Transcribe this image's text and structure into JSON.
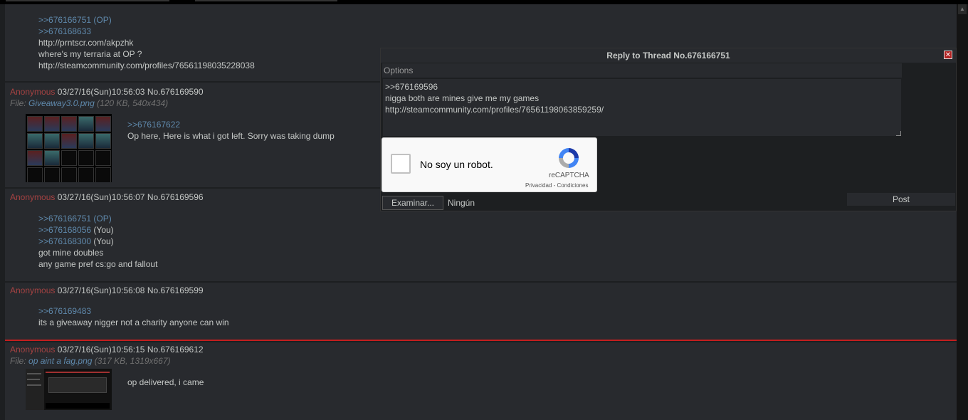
{
  "posts": [
    {
      "lines": [
        {
          "quote": ">>676166751 (OP)"
        },
        {
          "quote": ">>676168633"
        },
        {
          "text": "http://prntscr.com/akpzhk"
        },
        {
          "text": "where's my terraria at OP ?"
        },
        {
          "text": "http://steamcommunity.com/profiles/76561198035228038"
        }
      ]
    },
    {
      "name": "Anonymous",
      "date": "03/27/16(Sun)10:56:03",
      "no": "No.676169590",
      "file_prefix": "File: ",
      "file_name": "Giveaway3.0.png",
      "file_info": " (120 KB, 540x434)",
      "lines": [
        {
          "quote": ">>676167622"
        },
        {
          "text": "Op here, Here is what i got left. Sorry was taking dump"
        }
      ]
    },
    {
      "name": "Anonymous",
      "date": "03/27/16(Sun)10:56:07",
      "no": "No.676169596",
      "lines": [
        {
          "quote": ">>676166751 (OP)"
        },
        {
          "quote": ">>676168056",
          "suffix": " (You)"
        },
        {
          "quote": ">>676168300",
          "suffix": " (You)"
        },
        {
          "text": "got mine doubles"
        },
        {
          "text": "any game pref cs:go and fallout"
        }
      ]
    },
    {
      "name": "Anonymous",
      "date": "03/27/16(Sun)10:56:08",
      "no": "No.676169599",
      "lines": [
        {
          "quote": ">>676169483"
        },
        {
          "text": "its a giveaway nigger not a charity anyone can win"
        }
      ]
    },
    {
      "name": "Anonymous",
      "date": "03/27/16(Sun)10:56:15",
      "no": "No.676169612",
      "file_prefix": "File: ",
      "file_name": "op aint a fag.png",
      "file_info": " (317 KB, 1319x667)",
      "lines": [
        {
          "text": "op delivered, i came"
        }
      ]
    }
  ],
  "quick_reply": {
    "title": "Reply to Thread No.676166751",
    "close_glyph": "✕",
    "options_placeholder": "Options",
    "comment": ">>676169596\nnigga both are mines give me my games\nhttp://steamcommunity.com/profiles/76561198063859259/",
    "captcha_label": "No soy un robot.",
    "captcha_brand": "reCAPTCHA",
    "captcha_links": "Privacidad - Condiciones",
    "file_button": "Examinar...",
    "file_status": "Ningún archivo seleccionado.",
    "post_button": "Post"
  },
  "colors": {
    "background": "#1d1f21",
    "post_bg": "#282a2e",
    "name": "#a54242",
    "quotelink": "#5f89ac",
    "highlight_border": "#c41e1e"
  }
}
